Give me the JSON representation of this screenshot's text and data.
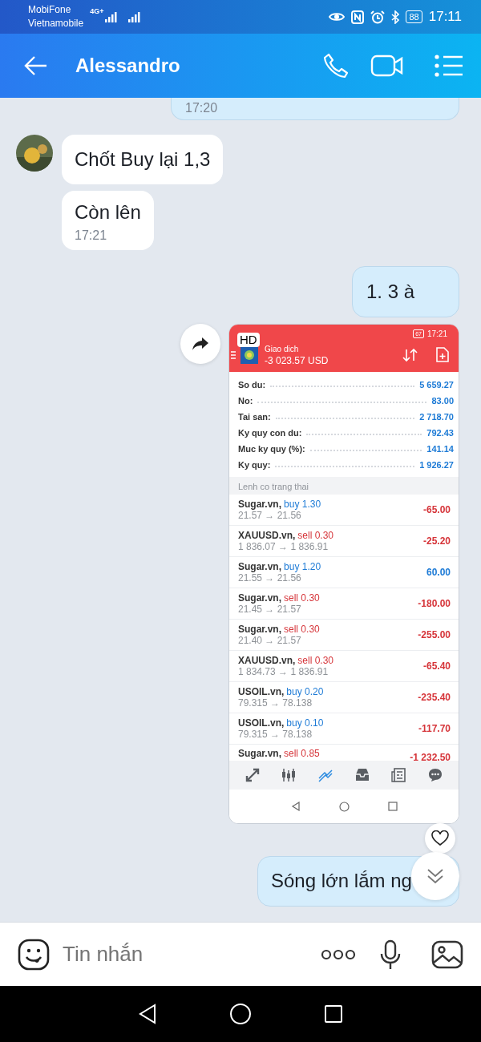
{
  "status_bar": {
    "carriers": [
      "MobiFone",
      "Vietnamobile"
    ],
    "network": "4G+",
    "battery": "88",
    "time": "17:11"
  },
  "header": {
    "title": "Alessandro"
  },
  "messages": [
    {
      "kind": "time_only",
      "outgoing": true,
      "time": "17:20"
    },
    {
      "kind": "text",
      "outgoing": false,
      "avatar": true,
      "text": "Chốt Buy lại 1,3"
    },
    {
      "kind": "text",
      "outgoing": false,
      "avatar": false,
      "text": "Còn lên",
      "time": "17:21"
    },
    {
      "kind": "text",
      "outgoing": true,
      "text": "1. 3 à"
    },
    {
      "kind": "image",
      "outgoing": true,
      "screenshot": {
        "status_time": "17:21",
        "battery": "67",
        "hd_badge": "HD",
        "title": "Giao dich",
        "balance": "-3 023.57 USD",
        "account": [
          {
            "label": "So du:",
            "value": "5 659.27"
          },
          {
            "label": "No:",
            "value": "83.00"
          },
          {
            "label": "Tai san:",
            "value": "2 718.70"
          },
          {
            "label": "Ky quy con du:",
            "value": "792.43"
          },
          {
            "label": "Muc ky quy (%):",
            "value": "141.14"
          },
          {
            "label": "Ky quy:",
            "value": "1 926.27"
          }
        ],
        "section": "Lenh co trang thai",
        "orders": [
          {
            "symbol": "Sugar.vn,",
            "buy": true,
            "trade": "buy 1.30",
            "prices": "21.57 → 21.56",
            "profit": "-65.00",
            "loss": true
          },
          {
            "symbol": "XAUUSD.vn,",
            "buy": false,
            "trade": "sell 0.30",
            "prices": "1 836.07 → 1 836.91",
            "profit": "-25.20",
            "loss": true
          },
          {
            "symbol": "Sugar.vn,",
            "buy": true,
            "trade": "buy 1.20",
            "prices": "21.55 → 21.56",
            "profit": "60.00",
            "loss": false
          },
          {
            "symbol": "Sugar.vn,",
            "buy": false,
            "trade": "sell 0.30",
            "prices": "21.45 → 21.57",
            "profit": "-180.00",
            "loss": true
          },
          {
            "symbol": "Sugar.vn,",
            "buy": false,
            "trade": "sell 0.30",
            "prices": "21.40 → 21.57",
            "profit": "-255.00",
            "loss": true
          },
          {
            "symbol": "XAUUSD.vn,",
            "buy": false,
            "trade": "sell 0.30",
            "prices": "1 834.73 → 1 836.91",
            "profit": "-65.40",
            "loss": true
          },
          {
            "symbol": "USOIL.vn,",
            "buy": true,
            "trade": "buy 0.20",
            "prices": "79.315 → 78.138",
            "profit": "-235.40",
            "loss": true
          },
          {
            "symbol": "USOIL.vn,",
            "buy": true,
            "trade": "buy 0.10",
            "prices": "79.315 → 78.138",
            "profit": "-117.70",
            "loss": true
          },
          {
            "symbol": "Sugar.vn,",
            "buy": false,
            "trade": "sell 0.85",
            "profit": "-1 232.50",
            "loss": true
          }
        ],
        "tabs": [
          {
            "kind": "arrows",
            "selected": false
          },
          {
            "kind": "candles",
            "selected": false
          },
          {
            "kind": "chart",
            "selected": true
          },
          {
            "kind": "inbox",
            "selected": false
          },
          {
            "kind": "news",
            "selected": false
          },
          {
            "kind": "chat",
            "selected": false
          }
        ]
      }
    },
    {
      "kind": "text",
      "outgoing": true,
      "text": "Sóng lớn lắm ng"
    }
  ],
  "composer": {
    "placeholder": "Tin nhắn"
  }
}
